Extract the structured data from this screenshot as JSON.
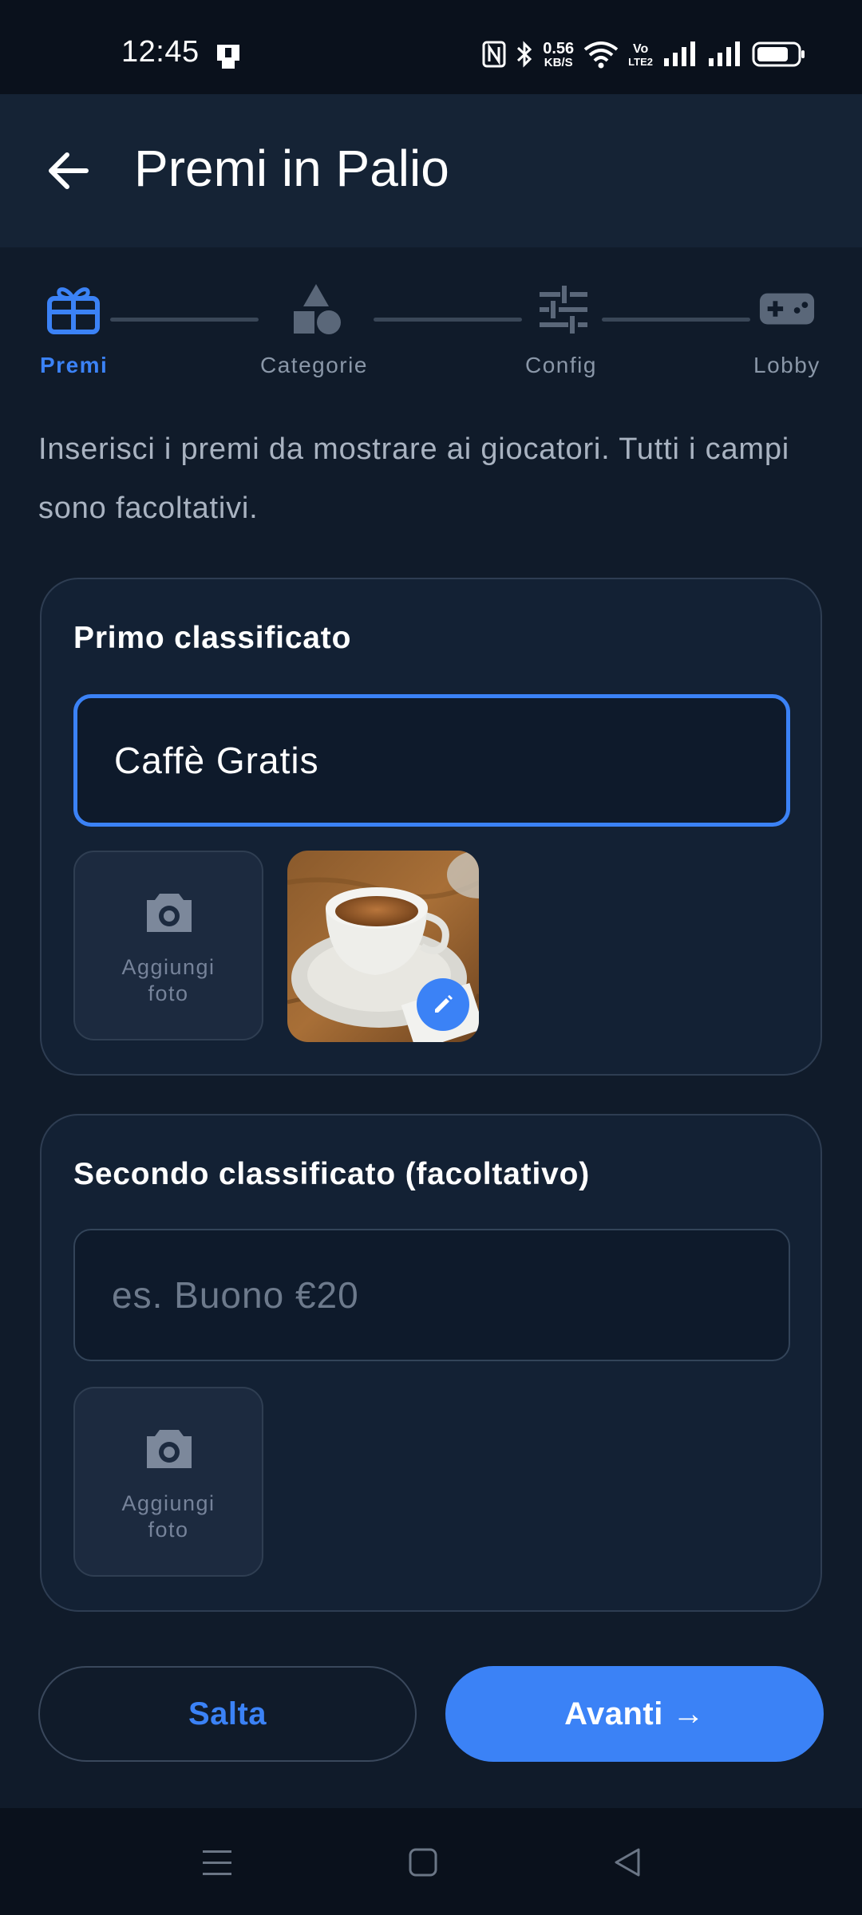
{
  "status_bar": {
    "time": "12:45",
    "net_speed_value": "0.56",
    "net_speed_unit": "KB/S",
    "volte_top": "Vo",
    "volte_bottom": "LTE2",
    "icons": [
      "sim-card-icon",
      "nfc-icon",
      "bluetooth-icon",
      "wifi-icon",
      "signal-icon",
      "signal-icon",
      "battery-icon"
    ]
  },
  "header": {
    "title": "Premi in Palio"
  },
  "stepper": {
    "active_index": 0,
    "steps": [
      {
        "label": "Premi",
        "icon": "gift-icon"
      },
      {
        "label": "Categorie",
        "icon": "shapes-icon"
      },
      {
        "label": "Config",
        "icon": "sliders-icon"
      },
      {
        "label": "Lobby",
        "icon": "gamepad-icon"
      }
    ]
  },
  "intro_text": "Inserisci i premi da mostrare ai giocatori. Tutti i campi sono facoltativi.",
  "first_prize": {
    "title": "Primo classificato",
    "value": "Caffè Gratis",
    "add_photo_label_1": "Aggiungi",
    "add_photo_label_2": "foto",
    "photo_alt": "coffee cup photo"
  },
  "second_prize": {
    "title": "Secondo classificato (facoltativo)",
    "value": "",
    "placeholder": "es. Buono €20",
    "add_photo_label_1": "Aggiungi",
    "add_photo_label_2": "foto"
  },
  "actions": {
    "skip": "Salta",
    "next": "Avanti →"
  },
  "colors": {
    "accent": "#3b82f6",
    "background": "#101b2a",
    "card": "#132134",
    "muted": "#8a97a8"
  }
}
